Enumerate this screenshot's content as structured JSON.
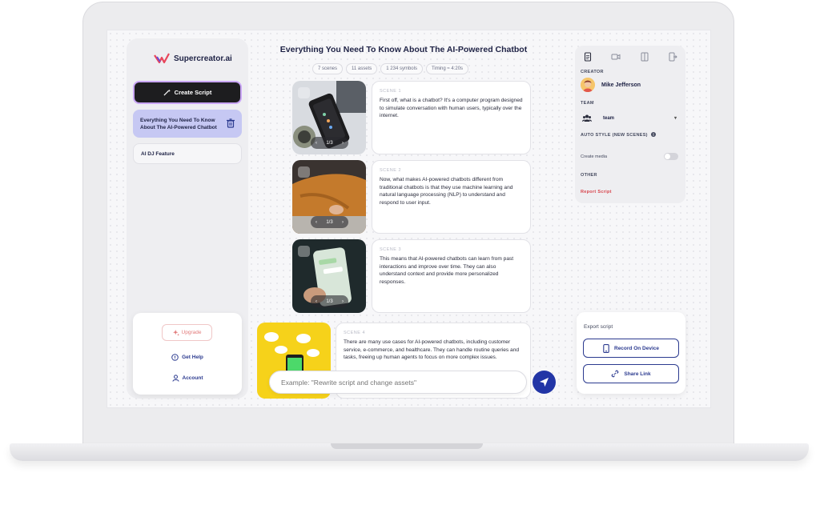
{
  "brand": {
    "name": "Supercreator.ai"
  },
  "sidebar": {
    "create_label": "Create Script",
    "scripts": [
      {
        "title": "Everything You Need To Know About The AI-Powered Chatbot"
      },
      {
        "title": "AI DJ Feature"
      }
    ],
    "upgrade_label": "Upgrade",
    "help_label": "Get Help",
    "account_label": "Account"
  },
  "document": {
    "title": "Everything You Need To Know About The AI-Powered Chatbot",
    "chips": [
      "7 scenes",
      "11 assets",
      "1 234 symbols",
      "Timing ≈ 4:20s"
    ]
  },
  "scenes": [
    {
      "label": "SCENE 1",
      "pager": "1/3",
      "text": "First off, what is a chatbot? It's a computer program designed to simulate conversation with human users, typically over the internet."
    },
    {
      "label": "SCENE 2",
      "pager": "1/3",
      "text": "Now, what makes AI-powered chatbots different from traditional chatbots is that they use machine learning and natural language processing (NLP) to understand and respond to user input."
    },
    {
      "label": "SCENE 3",
      "pager": "1/3",
      "text": "This means that AI-powered chatbots can learn from past interactions and improve over time. They can also understand context and provide more personalized responses."
    },
    {
      "label": "SCENE 4",
      "text": "There are many use cases for AI-powered chatbots, including customer service, e-commerce, and healthcare. They can handle routine queries and tasks, freeing up human agents to focus on more complex issues."
    }
  ],
  "prompt": {
    "placeholder": "Example: \"Rewrite script and change assets\""
  },
  "right_panel": {
    "creator_label": "CREATOR",
    "creator_name": "Mike Jefferson",
    "team_label": "TEAM",
    "team_value": "team",
    "auto_style_label": "AUTO STYLE (NEW SCENES)",
    "create_media_label": "Create media",
    "other_label": "OTHER",
    "report_label": "Report Script"
  },
  "export": {
    "title": "Export script",
    "record_label": "Record On Device",
    "share_label": "Share Link"
  },
  "colors": {
    "accent": "#2235a6",
    "selected": "#c6c8f3",
    "danger": "#d7434b"
  }
}
